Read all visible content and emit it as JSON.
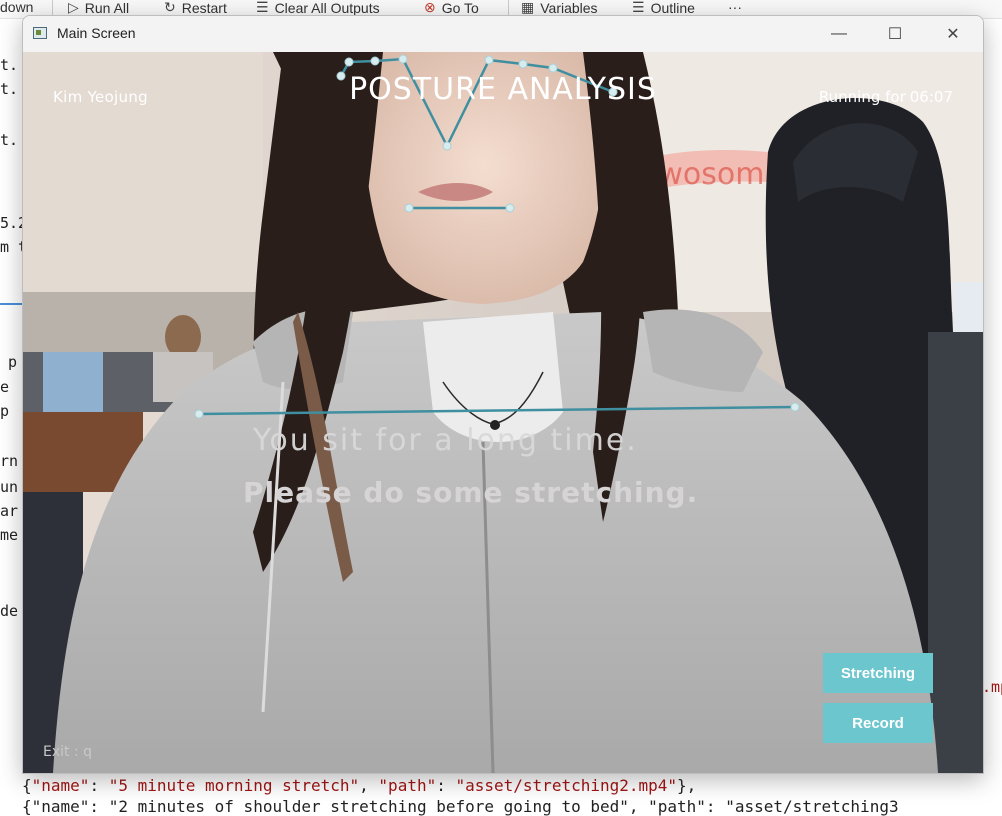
{
  "ide": {
    "toolbar": [
      {
        "label": "down",
        "icon": ""
      },
      {
        "label": "Run All",
        "icon": "run-all-icon"
      },
      {
        "label": "Restart",
        "icon": "restart-icon"
      },
      {
        "label": "Clear All Outputs",
        "icon": "clear-outputs-icon"
      },
      {
        "label": "Go To",
        "icon": "goto-icon"
      },
      {
        "label": "Variables",
        "icon": "variables-icon"
      },
      {
        "label": "Outline",
        "icon": "outline-icon"
      },
      {
        "label": "···",
        "icon": "more-icon"
      }
    ],
    "left_fragments": [
      "t.",
      "t.",
      "t.",
      "5.2",
      "m t",
      "p",
      "e",
      "p",
      "rn",
      "un",
      "ar",
      "me",
      "de"
    ],
    "right_fragment": ".mp",
    "bottom_line_1": {
      "prefix": "{",
      "k1": "\"name\"",
      "v1": "\"5 minute morning stretch\"",
      "k2": "\"path\"",
      "v2": "\"asset/stretching2.mp4\"",
      "suffix": "},"
    },
    "bottom_line_2": "{\"name\": \"2 minutes of shoulder stretching before going to bed\", \"path\": \"asset/stretching3"
  },
  "window": {
    "title": "Main Screen",
    "minimize": "—",
    "maximize": "☐",
    "close": "✕"
  },
  "app": {
    "user_name": "Kim Yeojung",
    "heading": "POSTURE ANALYSIS",
    "timer_label": "Running for",
    "timer_value": "06:07",
    "message_line1": "You sit for a long time.",
    "message_line2": "Please do some stretching.",
    "stretching_button": "Stretching",
    "record_button": "Record",
    "exit_hint": "Exit : q"
  },
  "colors": {
    "accent": "#6cc6cd",
    "landmark_line": "#3f8fa0",
    "landmark_point": "#d7ecef"
  }
}
